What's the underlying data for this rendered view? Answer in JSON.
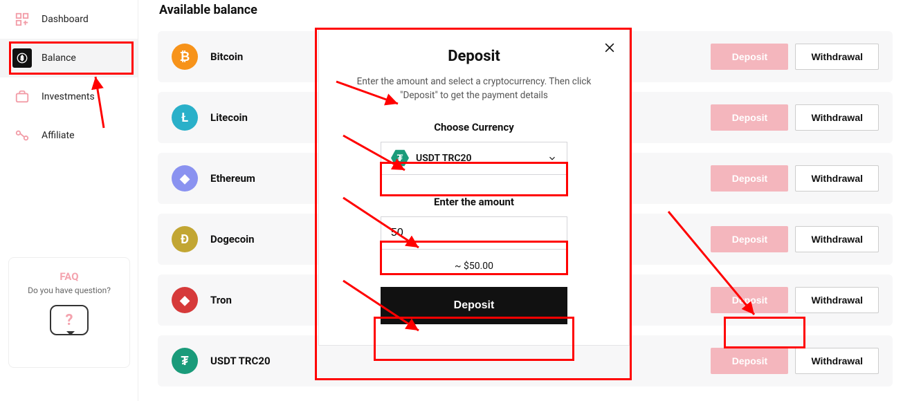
{
  "sidebar": {
    "items": [
      {
        "label": "Dashboard"
      },
      {
        "label": "Balance"
      },
      {
        "label": "Investments"
      },
      {
        "label": "Affiliate"
      }
    ],
    "faq": {
      "title": "FAQ",
      "subtitle": "Do you have question?",
      "glyph": "?"
    }
  },
  "main": {
    "heading": "Available balance",
    "deposit_label": "Deposit",
    "withdraw_label": "Withdrawal",
    "coins": [
      {
        "name": "Bitcoin",
        "bg": "#f7931a",
        "glyph": "₿"
      },
      {
        "name": "Litecoin",
        "bg": "#2ab0c9",
        "glyph": "Ł"
      },
      {
        "name": "Ethereum",
        "bg": "#8a92f0",
        "glyph": "◆"
      },
      {
        "name": "Dogecoin",
        "bg": "#c2a633",
        "glyph": "Ð"
      },
      {
        "name": "Tron",
        "bg": "#d63a3a",
        "glyph": "◆"
      },
      {
        "name": "USDT TRC20",
        "bg": "#1a9b7a",
        "glyph": "₮"
      }
    ]
  },
  "modal": {
    "title": "Deposit",
    "desc": "Enter the amount and select a cryptocurrency. Then click \"Deposit\" to get the payment details",
    "choose_label": "Choose Currency",
    "selected_currency": "USDT TRC20",
    "amount_label": "Enter the amount",
    "amount_value": "50",
    "approx": "~ $50.00",
    "button": "Deposit"
  }
}
